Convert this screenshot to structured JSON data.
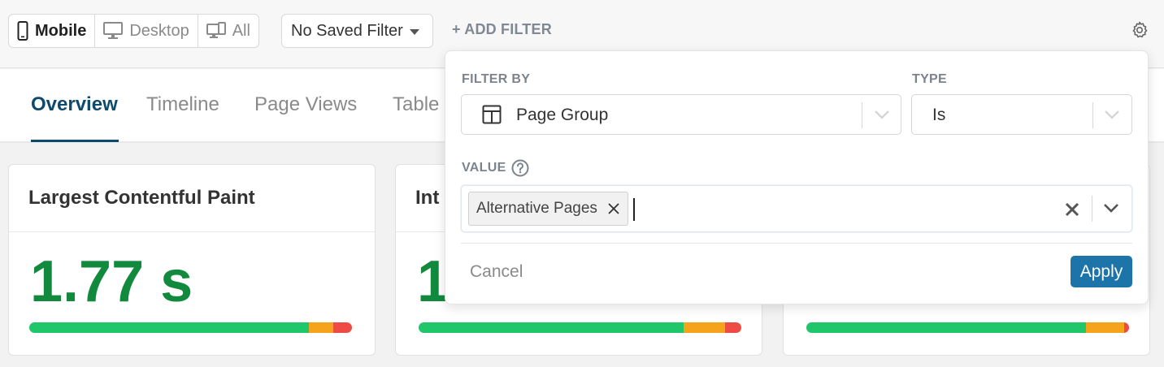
{
  "toolbar": {
    "devices": [
      {
        "label": "Mobile",
        "icon": "mobile-icon",
        "active": true
      },
      {
        "label": "Desktop",
        "icon": "desktop-icon",
        "active": false
      },
      {
        "label": "All",
        "icon": "all-devices-icon",
        "active": false
      }
    ],
    "saved_filter": "No Saved Filter",
    "add_filter": "+ ADD FILTER",
    "settings_icon": "gear-icon"
  },
  "tabs": [
    {
      "label": "Overview",
      "active": true
    },
    {
      "label": "Timeline",
      "active": false
    },
    {
      "label": "Page Views",
      "active": false
    },
    {
      "label": "Table",
      "active": false
    }
  ],
  "cards": [
    {
      "title": "Largest Contentful Paint",
      "value": "1.77 s",
      "distribution": [
        0.867,
        0.076,
        0.057
      ]
    },
    {
      "title": "Int",
      "value": "1",
      "distribution": [
        0.82,
        0.13,
        0.05
      ]
    },
    {
      "title": "",
      "value": "",
      "distribution": [
        0.866,
        0.119,
        0.015
      ]
    }
  ],
  "filter_popover": {
    "filter_by_label": "FILTER BY",
    "filter_by_value": "Page Group",
    "filter_by_icon": "page-layout-icon",
    "type_label": "TYPE",
    "type_value": "Is",
    "value_label": "VALUE",
    "help_icon": "help-circle-icon",
    "selected_values": [
      "Alternative Pages"
    ],
    "cancel": "Cancel",
    "apply": "Apply"
  },
  "colors": {
    "accent": "#0d4a6b",
    "apply_button": "#1d74a8",
    "good": "#1fc66a",
    "needs_improvement": "#f5a31a",
    "poor": "#ef4b45",
    "metric_value": "#118a3e"
  }
}
